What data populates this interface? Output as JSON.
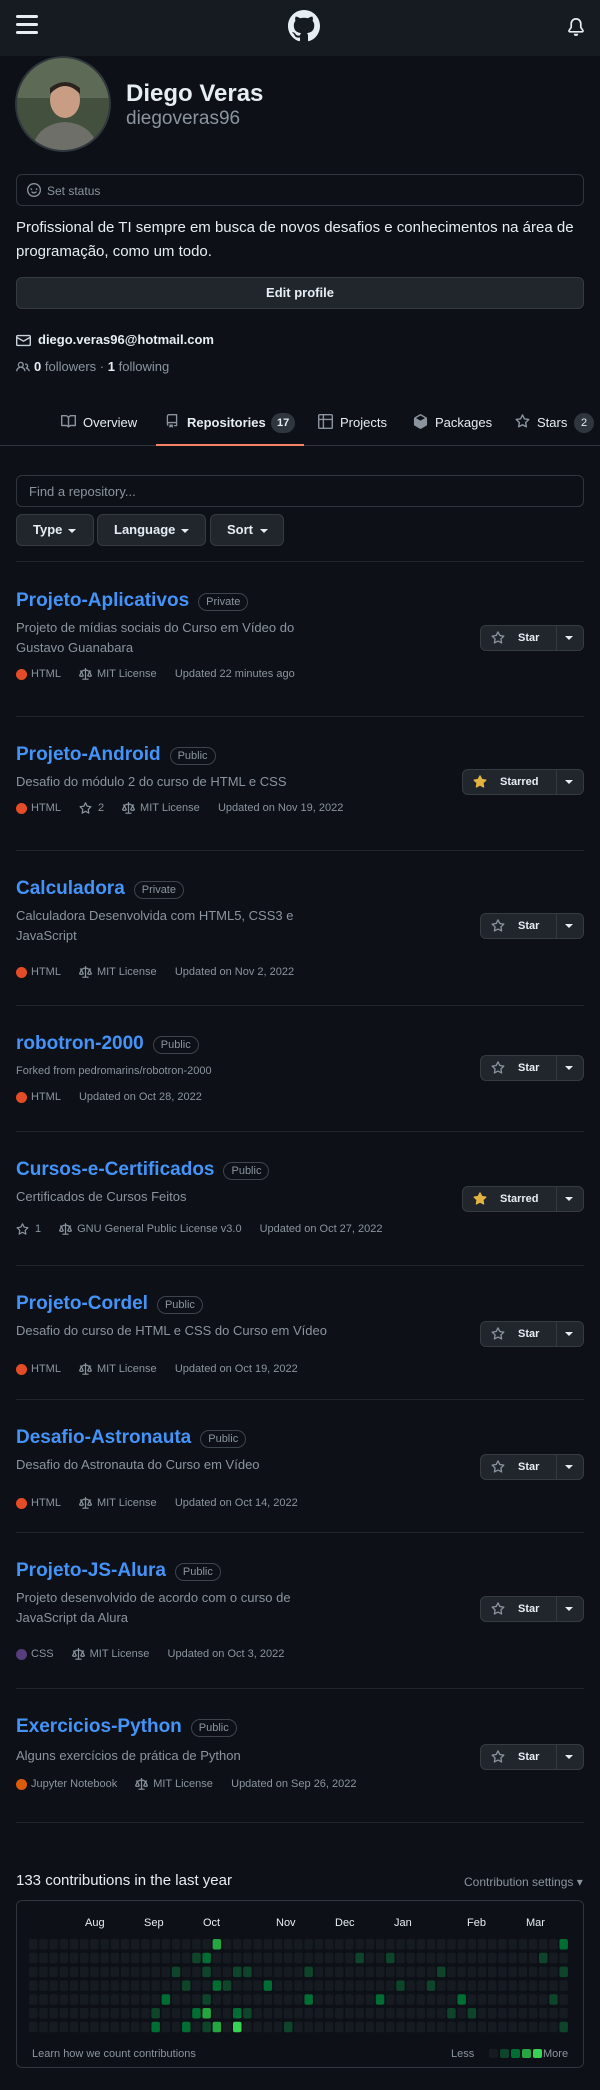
{
  "header": {
    "menu_icon": "hamburger-icon",
    "logo_icon": "github-logo-icon",
    "bell_icon": "bell-icon"
  },
  "profile": {
    "fullname": "Diego Veras",
    "username": "diegoveras96",
    "status_label": "Set status",
    "bio": "Profissional de TI sempre em busca de novos desafios e conhecimentos na área de programação, como um todo.",
    "edit_label": "Edit profile",
    "email": "diego.veras96@hotmail.com",
    "followers_count": "0",
    "followers_label": "followers",
    "dot": "·",
    "following_count": "1",
    "following_label": "following"
  },
  "tabs": [
    {
      "label": "Overview",
      "icon": "book-icon"
    },
    {
      "label": "Repositories",
      "icon": "repo-icon",
      "count": "17"
    },
    {
      "label": "Projects",
      "icon": "table-icon"
    },
    {
      "label": "Packages",
      "icon": "package-icon"
    },
    {
      "label": "Stars",
      "icon": "star-icon",
      "count": "2"
    }
  ],
  "filters": {
    "placeholder": "Find a repository...",
    "type_label": "Type",
    "language_label": "Language",
    "sort_label": "Sort"
  },
  "colors": {
    "html": "#e34c26",
    "css": "#563d7c",
    "jupyter": "#da5b0b",
    "accent": "#4493f8",
    "starred": "#e3b341"
  },
  "repos": [
    {
      "name": "Projeto-Aplicativos",
      "visibility": "Private",
      "desc": "Projeto de mídias sociais do Curso em Vídeo do Gustavo Guanabara",
      "lang": "HTML",
      "license": "MIT License",
      "updated": "Updated 22 minutes ago",
      "star_label": "Star"
    },
    {
      "name": "Projeto-Android",
      "visibility": "Public",
      "desc": "Desafio do módulo 2 do curso de HTML e CSS",
      "lang": "HTML",
      "stars": "2",
      "license": "MIT License",
      "updated": "Updated on Nov 19, 2022",
      "star_label": "Starred"
    },
    {
      "name": "Calculadora",
      "visibility": "Private",
      "desc": "Calculadora Desenvolvida com HTML5, CSS3 e JavaScript",
      "lang": "HTML",
      "license": "MIT License",
      "updated": "Updated on Nov 2, 2022",
      "star_label": "Star"
    },
    {
      "name": "robotron-2000",
      "visibility": "Public",
      "desc": "Forked from pedromarins/robotron-2000",
      "lang": "HTML",
      "updated": "Updated on Oct 28, 2022",
      "star_label": "Star"
    },
    {
      "name": "Cursos-e-Certificados",
      "visibility": "Public",
      "desc": "Certificados de Cursos Feitos",
      "stars": "1",
      "license": "GNU General Public License v3.0",
      "updated": "Updated on Oct 27, 2022",
      "star_label": "Starred"
    },
    {
      "name": "Projeto-Cordel",
      "visibility": "Public",
      "desc": "Desafio do curso de HTML e CSS do Curso em Vídeo",
      "lang": "HTML",
      "license": "MIT License",
      "updated": "Updated on Oct 19, 2022",
      "star_label": "Star"
    },
    {
      "name": "Desafio-Astronauta",
      "visibility": "Public",
      "desc": "Desafio do Astronauta do Curso em Vídeo",
      "lang": "HTML",
      "license": "MIT License",
      "updated": "Updated on Oct 14, 2022",
      "star_label": "Star"
    },
    {
      "name": "Projeto-JS-Alura",
      "visibility": "Public",
      "desc": "Projeto desenvolvido de acordo com o curso de JavaScript da Alura",
      "lang": "CSS",
      "license": "MIT License",
      "updated": "Updated on Oct 3, 2022",
      "star_label": "Star"
    },
    {
      "name": "Exercicios-Python",
      "visibility": "Public",
      "desc": "Alguns exercícios de prática de Python",
      "lang": "Jupyter Notebook",
      "license": "MIT License",
      "updated": "Updated on Sep 26, 2022",
      "star_label": "Star"
    }
  ],
  "contributions": {
    "title": "133 contributions in the last year",
    "settings_label": "Contribution settings ▾",
    "months": [
      "Aug",
      "Sep",
      "Oct",
      "Nov",
      "Dec",
      "Jan",
      "Feb",
      "Mar"
    ],
    "learn_label": "Learn how we count contributions",
    "less_label": "Less",
    "more_label": "More"
  }
}
